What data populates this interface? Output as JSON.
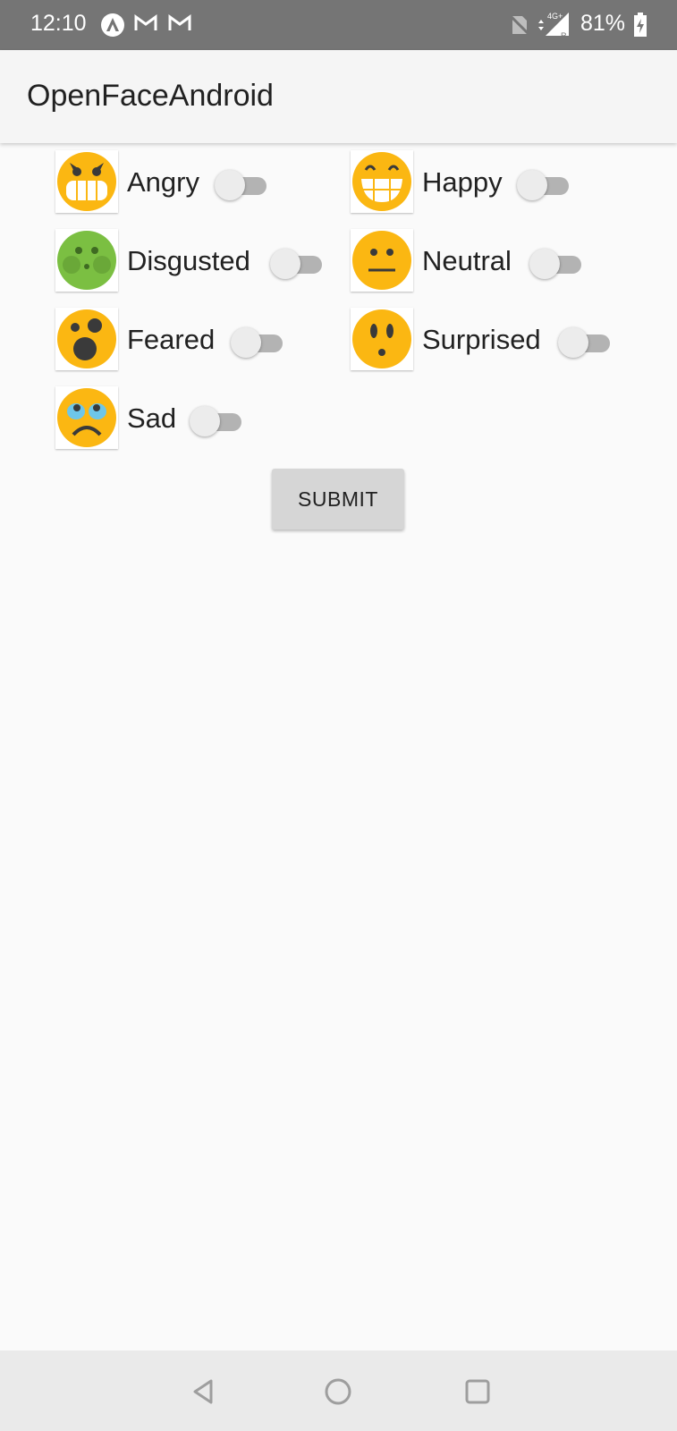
{
  "status_bar": {
    "time": "12:10",
    "battery": "81%",
    "icons": [
      "android-a-icon",
      "gmail-icon",
      "gmail-icon",
      "no-sim-icon",
      "network-4g-icon",
      "signal-icon",
      "battery-charging-icon"
    ],
    "network_label": "4G+"
  },
  "app_bar": {
    "title": "OpenFaceAndroid"
  },
  "emotions": {
    "angry": {
      "label": "Angry",
      "icon": "angry-face-icon",
      "checked": false
    },
    "happy": {
      "label": "Happy",
      "icon": "happy-face-icon",
      "checked": false
    },
    "disgusted": {
      "label": "Disgusted",
      "icon": "disgusted-face-icon",
      "checked": false
    },
    "neutral": {
      "label": "Neutral",
      "icon": "neutral-face-icon",
      "checked": false
    },
    "feared": {
      "label": "Feared",
      "icon": "feared-face-icon",
      "checked": false
    },
    "surprised": {
      "label": "Surprised",
      "icon": "surprised-face-icon",
      "checked": false
    },
    "sad": {
      "label": "Sad",
      "icon": "sad-face-icon",
      "checked": false
    }
  },
  "submit_label": "SUBMIT",
  "nav_bar": {
    "buttons": [
      "back-icon",
      "home-icon",
      "recents-icon"
    ]
  },
  "colors": {
    "status_bar": "#757575",
    "app_bar": "#f5f5f5",
    "face_yellow": "#fbb712",
    "face_green": "#7bbf42",
    "switch_track": "#b3b3b3",
    "switch_thumb": "#ececec",
    "button": "#d6d6d6"
  }
}
